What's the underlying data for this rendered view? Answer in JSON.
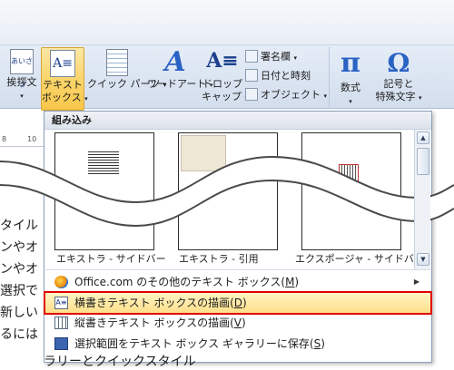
{
  "ribbon": {
    "buttons": {
      "greeting": "挨拶文",
      "textbox_line1": "テキスト",
      "textbox_line2": "ボックス",
      "quickparts": "クイック パーツ",
      "wordart": "ワードアート",
      "dropcap_line1": "ドロップ",
      "dropcap_line2": "キャップ",
      "signature": "署名欄",
      "datetime": "日付と時刻",
      "object": "オブジェクト",
      "equation": "数式",
      "symbol_line1": "記号と",
      "symbol_line2": "特殊文字"
    },
    "caret": "▾"
  },
  "ruler": {
    "marks": [
      "8",
      "10"
    ]
  },
  "document": {
    "lines": [
      "タイル",
      "ンやオ",
      "ンやオ",
      "選択で",
      "新しい",
      "るには"
    ],
    "bottom_line": "ラリーとクイックスタイル"
  },
  "panel": {
    "header": "組み込み",
    "thumbnails": [
      {
        "caption": "エキストラ - サイドバー"
      },
      {
        "caption": "エキストラ - 引用"
      },
      {
        "caption": "エクスポージャ - サイドバー"
      }
    ],
    "menu": [
      {
        "label": "Office.com のその他のテキスト ボックス(M)",
        "pre": "Office.com のその他のテキスト ボックス(",
        "key": "M",
        "post": ")",
        "has_submenu": true,
        "highlighted": false
      },
      {
        "label": "横書きテキスト ボックスの描画(D)",
        "pre": "横書きテキスト ボックスの描画(",
        "key": "D",
        "post": ")",
        "has_submenu": false,
        "highlighted": true
      },
      {
        "label": "縦書きテキスト ボックスの描画(V)",
        "pre": "縦書きテキスト ボックスの描画(",
        "key": "V",
        "post": ")",
        "has_submenu": false,
        "highlighted": false
      },
      {
        "label": "選択範囲をテキスト ボックス ギャラリーに保存(S)",
        "pre": "選択範囲をテキスト ボックス ギャラリーに保存(",
        "key": "S",
        "post": ")",
        "has_submenu": false,
        "highlighted": false
      }
    ]
  },
  "colors": {
    "highlight_border": "#e00000",
    "highlight_fill": "#ffe08a"
  }
}
